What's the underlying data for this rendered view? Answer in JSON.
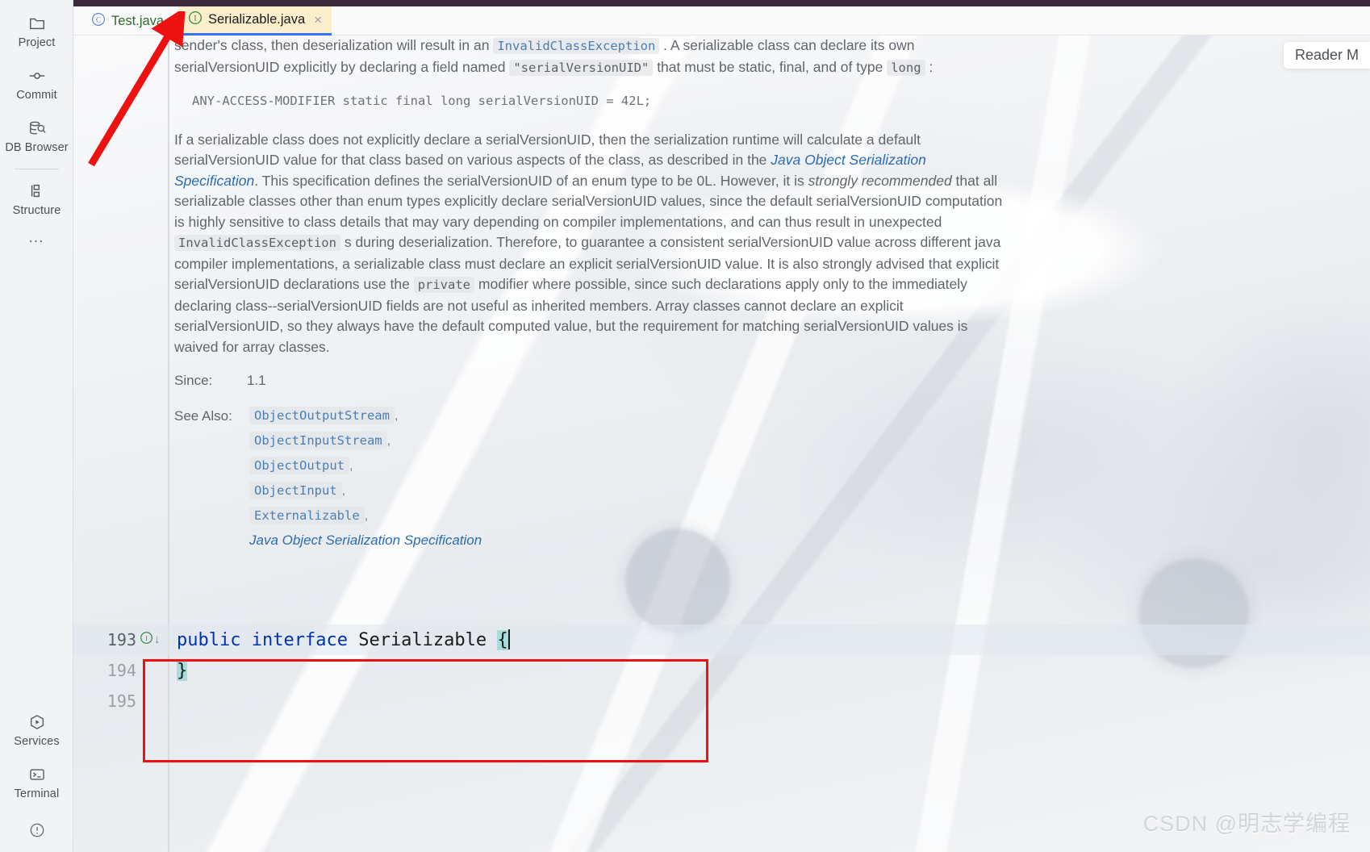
{
  "sidebar": {
    "top_items": [
      {
        "label": "Project",
        "icon": "folder-icon"
      },
      {
        "label": "Commit",
        "icon": "commit-icon"
      },
      {
        "label": "DB Browser",
        "icon": "database-search-icon"
      }
    ],
    "second_items": [
      {
        "label": "Structure",
        "icon": "structure-icon"
      }
    ],
    "more_label": "…",
    "bottom_items": [
      {
        "label": "Services",
        "icon": "services-play-icon"
      },
      {
        "label": "Terminal",
        "icon": "terminal-icon"
      }
    ],
    "problems_icon": "warning-circle-icon"
  },
  "tabs": [
    {
      "label": "Test.java",
      "icon": "java-class-icon",
      "active": false,
      "closable": false
    },
    {
      "label": "Serializable.java",
      "icon": "java-interface-icon",
      "active": true,
      "closable": true,
      "close_glyph": "×"
    }
  ],
  "reader_popup": {
    "label": "Reader M"
  },
  "doc": {
    "p1_prefix": "sender's class, then deserialization will result in an ",
    "p1_chip1": "InvalidClassException",
    "p1_mid": " . A serializable class can declare its own serialVersionUID explicitly by declaring a field named ",
    "p1_chip2": "\"serialVersionUID\"",
    "p1_mid2": " that must be static, final, and of type ",
    "p1_chip3": "long",
    "p1_suffix": " :",
    "snippet": "ANY-ACCESS-MODIFIER static final long serialVersionUID = 42L;",
    "p2_a": "If a serializable class does not explicitly declare a serialVersionUID, then the serialization runtime will calculate a default serialVersionUID value for that class based on various aspects of the class, as described in the ",
    "p2_link": "Java Object Serialization Specification",
    "p2_b": ". This specification defines the serialVersionUID of an enum type to be 0L. However, it is ",
    "p2_em": "strongly recommended",
    "p2_c": " that all serializable classes other than enum types explicitly declare serialVersionUID values, since the default serialVersionUID computation is highly sensitive to class details that may vary depending on compiler implementations, and can thus result in unexpected ",
    "p2_chip1": "InvalidClassException",
    "p2_d": " s during deserialization. Therefore, to guarantee a consistent serialVersionUID value across different java compiler implementations, a serializable class must declare an explicit serialVersionUID value. It is also strongly advised that explicit serialVersionUID declarations use the ",
    "p2_chip2": "private",
    "p2_e": " modifier where possible, since such declarations apply only to the immediately declaring class--serialVersionUID fields are not useful as inherited members. Array classes cannot declare an explicit serialVersionUID, so they always have the default computed value, but the requirement for matching serialVersionUID values is waived for array classes.",
    "since_key": "Since:",
    "since_val": "1.1",
    "see_also_key": "See Also:",
    "see_also": [
      {
        "text": "ObjectOutputStream",
        "comma": ","
      },
      {
        "text": "ObjectInputStream",
        "comma": ","
      },
      {
        "text": "ObjectOutput",
        "comma": ","
      },
      {
        "text": "ObjectInput",
        "comma": ","
      },
      {
        "text": "Externalizable",
        "comma": ","
      }
    ],
    "see_also_link": "Java Object Serialization Specification"
  },
  "code": {
    "lines": [
      {
        "number": "193",
        "gutter_icon": "java-interface-implemented-icon",
        "gutter_arrow": "↓",
        "kw1": "public",
        "kw2": "interface",
        "name": "Serializable",
        "brace": "{",
        "highlighted": true
      },
      {
        "number": "194",
        "close_brace": "}",
        "highlighted": false
      },
      {
        "number": "195",
        "text": "",
        "highlighted": false
      }
    ]
  },
  "annotations": {
    "red_box_color": "#ee1111",
    "arrow_color": "#ee1111"
  },
  "watermark": {
    "text": "CSDN @明志学编程"
  },
  "colors": {
    "accent_blue": "#3574f0",
    "active_tab_bg": "#faeecd",
    "keyword_blue": "#0033b3",
    "link_blue": "#2b6cb0",
    "interface_green": "#2d8a3e",
    "top_bar": "#3b2a3c"
  }
}
